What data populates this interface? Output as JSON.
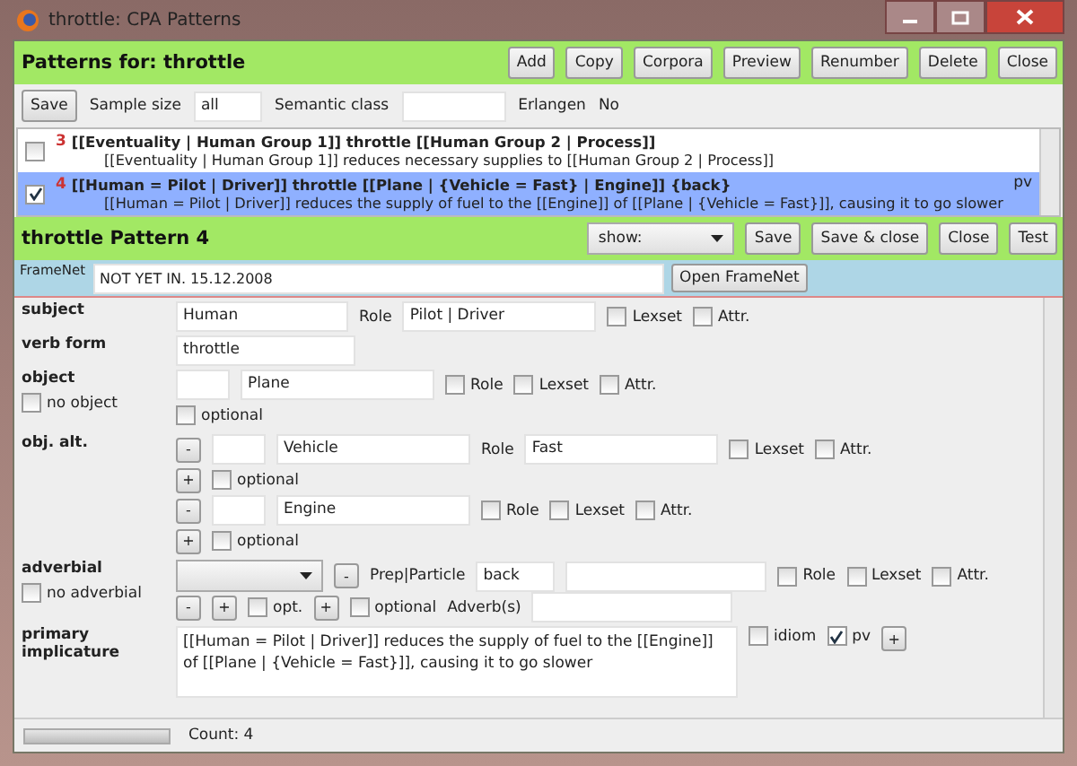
{
  "window": {
    "title": "throttle: CPA Patterns"
  },
  "header": {
    "title": "Patterns for:  throttle",
    "buttons": [
      "Add",
      "Copy",
      "Corpora",
      "Preview",
      "Renumber",
      "Delete",
      "Close"
    ]
  },
  "toolbar": {
    "save": "Save",
    "sample_label": "Sample size",
    "sample_value": "all",
    "semantic_label": "Semantic class",
    "erlangen_label": "Erlangen",
    "erlangen_value": "No"
  },
  "patterns": [
    {
      "number": "3",
      "pattern": "[[Eventuality | Human Group 1]] throttle [[Human Group 2 | Process]]",
      "implicature": "[[Eventuality | Human Group 1]] reduces necessary supplies to [[Human Group 2 | Process]]",
      "checked": false,
      "selected": false
    },
    {
      "number": "4",
      "pattern": "[[Human = Pilot | Driver]] throttle [[Plane | {Vehicle = Fast} | Engine]] {back}",
      "implicature": "[[Human = Pilot | Driver]] reduces the supply of fuel to the [[Engine]] of [[Plane | {Vehicle = Fast}]], causing it to go slower",
      "checked": true,
      "selected": true,
      "tag": "pv"
    }
  ],
  "editor": {
    "title": "throttle  Pattern  4",
    "show": "show:",
    "buttons": [
      "Save",
      "Save & close",
      "Close",
      "Test"
    ]
  },
  "framenet": {
    "label": "FrameNet",
    "value": "NOT YET IN. 15.12.2008",
    "button": "Open FrameNet"
  },
  "subject": {
    "label": "subject",
    "value": "Human",
    "role_label": "Role",
    "role": "Pilot | Driver",
    "checks": [
      {
        "label": "Lexset",
        "checked": false
      },
      {
        "label": "Attr.",
        "checked": false
      }
    ]
  },
  "verb_form": {
    "label": "verb form",
    "value": "throttle"
  },
  "object": {
    "label": "object",
    "value": "Plane",
    "checks": [
      {
        "label": "Role",
        "checked": false
      },
      {
        "label": "Lexset",
        "checked": false
      },
      {
        "label": "Attr.",
        "checked": false
      }
    ],
    "no_object": {
      "label": "no object",
      "checked": false
    },
    "optional": {
      "label": "optional",
      "checked": false
    }
  },
  "obj_alt": {
    "label": "obj. alt.",
    "alternatives": [
      {
        "minus": "-",
        "value": "Vehicle",
        "role_label": "Role",
        "role": "Fast",
        "checks": [
          {
            "label": "Lexset",
            "checked": false
          },
          {
            "label": "Attr.",
            "checked": false
          }
        ],
        "plus": "+",
        "optional": {
          "label": "optional",
          "checked": false
        }
      },
      {
        "minus": "-",
        "value": "Engine",
        "checks": [
          {
            "label": "Role",
            "checked": false
          },
          {
            "label": "Lexset",
            "checked": false
          },
          {
            "label": "Attr.",
            "checked": false
          }
        ],
        "plus": "+",
        "optional": {
          "label": "optional",
          "checked": false
        }
      }
    ]
  },
  "adverbial": {
    "label": "adverbial",
    "minus": "-",
    "prep_label": "Prep|Particle",
    "prep": "back",
    "checks": [
      {
        "label": "Role",
        "checked": false
      },
      {
        "label": "Lexset",
        "checked": false
      },
      {
        "label": "Attr.",
        "checked": false
      }
    ],
    "no_adverbial": {
      "label": "no adverbial",
      "checked": false
    },
    "row2_minus": "-",
    "row2_plus": "+",
    "opt": {
      "label": "opt.",
      "checked": false
    },
    "row2_plus2": "+",
    "optional": {
      "label": "optional",
      "checked": false
    },
    "adverbs_label": "Adverb(s)"
  },
  "implicature": {
    "label": "primary implicature",
    "text": "[[Human = Pilot | Driver]] reduces the supply of fuel to the [[Engine]] of [[Plane | {Vehicle = Fast}]], causing it to go slower",
    "checks": [
      {
        "label": "idiom",
        "checked": false
      },
      {
        "label": "pv",
        "checked": true
      }
    ],
    "plus": "+"
  },
  "status": {
    "count": "Count: 4",
    "level": 1
  }
}
